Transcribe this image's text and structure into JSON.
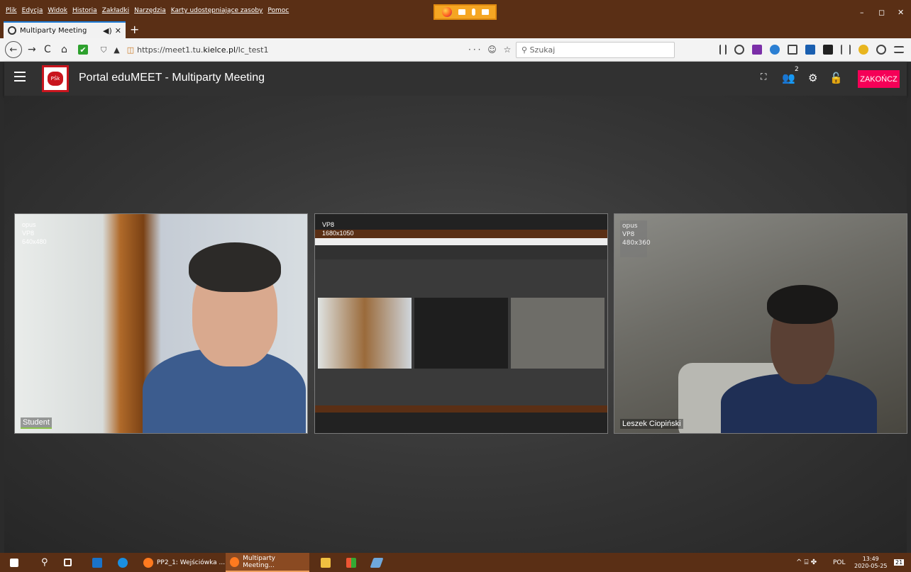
{
  "menu": [
    "Plik",
    "Edycja",
    "Widok",
    "Historia",
    "Zakładki",
    "Narzędzia",
    "Karty udostępniające zasoby",
    "Pomoc"
  ],
  "window_controls": {
    "minimize": "–",
    "restore": "◻",
    "close": "✕"
  },
  "tab": {
    "title": "Multiparty Meeting",
    "audio": "◀)",
    "close": "✕",
    "new": "+"
  },
  "nav": {
    "back": "←",
    "forward": "→",
    "reload": "C",
    "home": "⌂",
    "check": "✔",
    "shield": "⛉",
    "lock": "🔒",
    "page_actions": "··· ☺ ☆"
  },
  "url": {
    "prefix": "https://meet1.tu.",
    "domain": "kielce.pl",
    "path": "/lc_test1"
  },
  "search": {
    "placeholder": "Szukaj"
  },
  "app": {
    "title": "Portal eduMEET - Multiparty Meeting",
    "participants_count": "2",
    "leave_label": "ZAKOŃCZ",
    "logo_text": "PŚk"
  },
  "videos": [
    {
      "codec_audio": "opus",
      "codec_video": "VP8",
      "resolution": "640x480",
      "name": "Student"
    },
    {
      "codec_video": "VP8",
      "resolution": "1680x1050"
    },
    {
      "codec_audio": "opus",
      "codec_video": "VP8",
      "resolution": "480x360",
      "name": "Leszek Ciopiński"
    }
  ],
  "taskbar": {
    "items": [
      "PP2_1: Wejściówka ...",
      "Multiparty Meeting..."
    ],
    "lang": "POL",
    "time": "13:49",
    "date": "2020-05-25",
    "notif": "21"
  },
  "colors": {
    "browser_chrome": "#5a2f15",
    "leave": "#f50057",
    "appbar": "#313131"
  }
}
